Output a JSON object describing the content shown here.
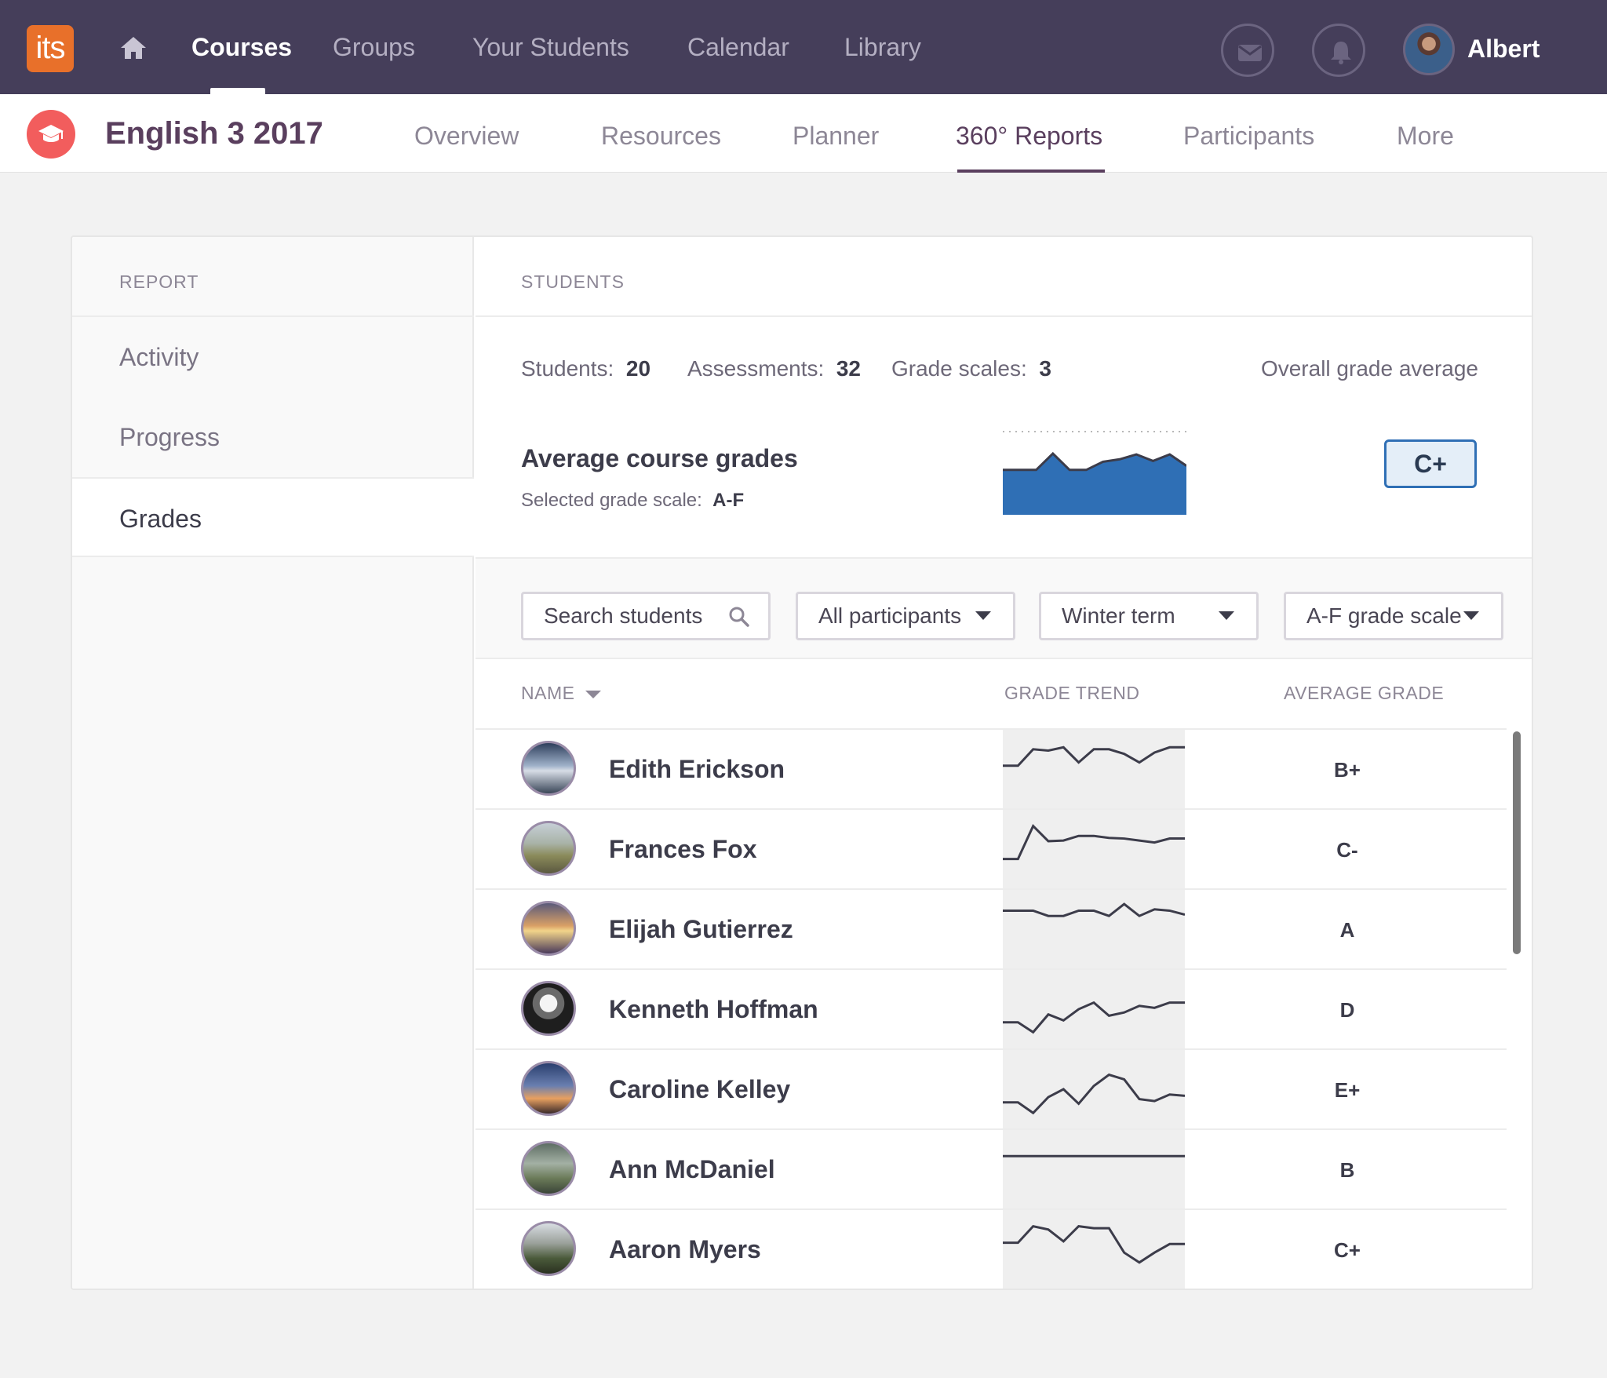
{
  "topnav": {
    "logo_text": "its",
    "items": [
      "Courses",
      "Groups",
      "Your Students",
      "Calendar",
      "Library"
    ],
    "active": "Courses",
    "icons": [
      "home-icon",
      "mail-icon",
      "bell-icon"
    ],
    "user_name": "Albert"
  },
  "course": {
    "title": "English 3 2017",
    "tabs": [
      "Overview",
      "Resources",
      "Planner",
      "360° Reports",
      "Participants",
      "More"
    ],
    "active_tab": "360° Reports"
  },
  "sidebar": {
    "header": "REPORT",
    "items": [
      "Activity",
      "Progress",
      "Grades"
    ],
    "active": "Grades"
  },
  "students": {
    "header": "STUDENTS",
    "stats": {
      "students_label": "Students:",
      "students_value": "20",
      "assessments_label": "Assessments:",
      "assessments_value": "32",
      "scales_label": "Grade scales:",
      "scales_value": "3"
    },
    "overall_label": "Overall grade average",
    "overall_grade": "C+",
    "avg_title": "Average course grades",
    "avg_sub_label": "Selected grade scale:",
    "avg_sub_value": "A-F",
    "avg_trend": [
      0.55,
      0.55,
      0.55,
      0.75,
      0.55,
      0.55,
      0.65,
      0.68,
      0.74,
      0.66,
      0.74,
      0.6
    ],
    "chart_fill_color": "#2f6fb5"
  },
  "filters": {
    "search_placeholder": "Search students",
    "participants": "All participants",
    "term": "Winter term",
    "scale": "A-F grade scale"
  },
  "table": {
    "columns": [
      "NAME",
      "GRADE TREND",
      "AVERAGE GRADE"
    ],
    "rows": [
      {
        "name": "Edith Erickson",
        "grade": "B+",
        "trend": [
          0.55,
          0.55,
          0.8,
          0.78,
          0.83,
          0.6,
          0.8,
          0.8,
          0.73,
          0.6,
          0.75,
          0.83,
          0.83
        ]
      },
      {
        "name": "Frances Fox",
        "grade": "C-",
        "trend": [
          0.35,
          0.35,
          0.85,
          0.62,
          0.63,
          0.7,
          0.7,
          0.67,
          0.66,
          0.63,
          0.6,
          0.66,
          0.66
        ]
      },
      {
        "name": "Elijah Gutierrez",
        "grade": "A",
        "trend": [
          0.78,
          0.78,
          0.78,
          0.7,
          0.7,
          0.78,
          0.78,
          0.7,
          0.88,
          0.7,
          0.8,
          0.78,
          0.72
        ]
      },
      {
        "name": "Kenneth Hoffman",
        "grade": "D",
        "trend": [
          0.3,
          0.3,
          0.15,
          0.42,
          0.33,
          0.5,
          0.6,
          0.4,
          0.45,
          0.55,
          0.52,
          0.6,
          0.6
        ]
      },
      {
        "name": "Caroline Kelley",
        "grade": "E+",
        "trend": [
          0.3,
          0.3,
          0.14,
          0.38,
          0.5,
          0.28,
          0.55,
          0.72,
          0.65,
          0.35,
          0.32,
          0.42,
          0.4
        ]
      },
      {
        "name": "Ann McDaniel",
        "grade": "B",
        "trend": [
          0.7,
          0.7,
          0.7,
          0.7,
          0.7,
          0.7,
          0.7,
          0.7,
          0.7,
          0.7,
          0.7,
          0.7,
          0.7
        ]
      },
      {
        "name": "Aaron Myers",
        "grade": "C+",
        "trend": [
          0.6,
          0.6,
          0.85,
          0.8,
          0.62,
          0.85,
          0.82,
          0.82,
          0.45,
          0.3,
          0.45,
          0.58,
          0.58
        ]
      }
    ]
  }
}
